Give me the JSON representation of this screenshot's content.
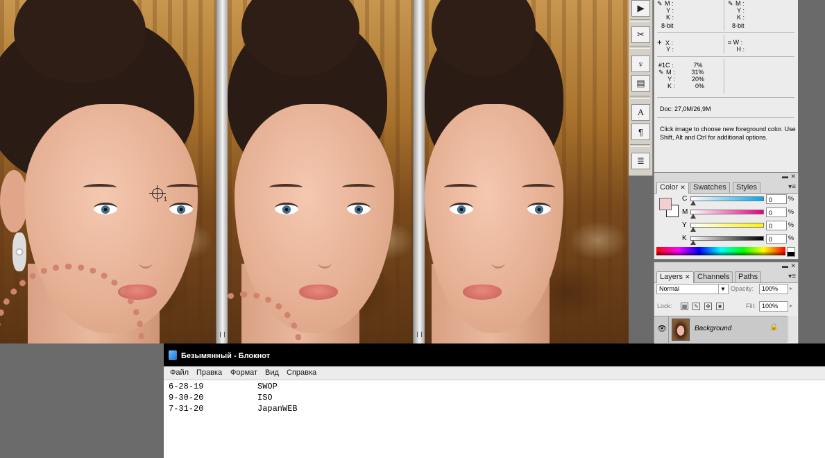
{
  "info_panel": {
    "top_left": {
      "m_label": "M :",
      "y_label": "Y :",
      "k_label": "K :",
      "bits": "8-bit"
    },
    "top_right": {
      "m_label": "M :",
      "y_label": "Y :",
      "k_label": "K :",
      "bits": "8-bit"
    },
    "xy": {
      "x_label": "X :",
      "y_label": "Y :"
    },
    "wh": {
      "w_label": "W :",
      "h_label": "H :"
    },
    "sampler": {
      "name": "#1C :",
      "c": "7%",
      "m_label": "M :",
      "m": "31%",
      "y_label": "Y :",
      "y": "20%",
      "k_label": "K :",
      "k": "0%"
    },
    "doc": "Doc: 27,0M/26,9M",
    "hint": "Click image to choose new foreground color.  Use Shift, Alt and Ctrl for additional options."
  },
  "color_panel": {
    "tabs": [
      "Color",
      "Swatches",
      "Styles"
    ],
    "channels": [
      {
        "label": "C",
        "value": "0",
        "pct": "%",
        "gradient": "linear-gradient(90deg,#ffffff,#00a8e8)"
      },
      {
        "label": "M",
        "value": "0",
        "pct": "%",
        "gradient": "linear-gradient(90deg,#ffffff,#e4007c)"
      },
      {
        "label": "Y",
        "value": "0",
        "pct": "%",
        "gradient": "linear-gradient(90deg,#ffffff,#fff200)"
      },
      {
        "label": "K",
        "value": "0",
        "pct": "%",
        "gradient": "linear-gradient(90deg,#ffffff,#000000)"
      }
    ],
    "foreground_color": "#f3cfcf",
    "background_color": "#ffffff"
  },
  "layers_panel": {
    "tabs": [
      "Layers",
      "Channels",
      "Paths"
    ],
    "blend_mode": "Normal",
    "opacity_label": "Opacity:",
    "opacity": "100%",
    "lock_label": "Lock:",
    "fill_label": "Fill:",
    "fill": "100%",
    "layer_name": "Background"
  },
  "sampler_marker": "1",
  "notepad": {
    "title": "Безымянный - Блокнот",
    "menu": [
      "Файл",
      "Правка",
      "Формат",
      "Вид",
      "Справка"
    ],
    "lines": [
      {
        "date": "6-28-19",
        "text": "SWOP"
      },
      {
        "date": "9-30-20",
        "text": "ISO"
      },
      {
        "date": "7-31-20",
        "text": "JapanWEB"
      }
    ]
  },
  "tool_icons": [
    "play-icon",
    "tools-icon",
    "clone-source-icon",
    "stamp-icon",
    "character-icon",
    "paragraph-icon",
    "notes-icon"
  ]
}
